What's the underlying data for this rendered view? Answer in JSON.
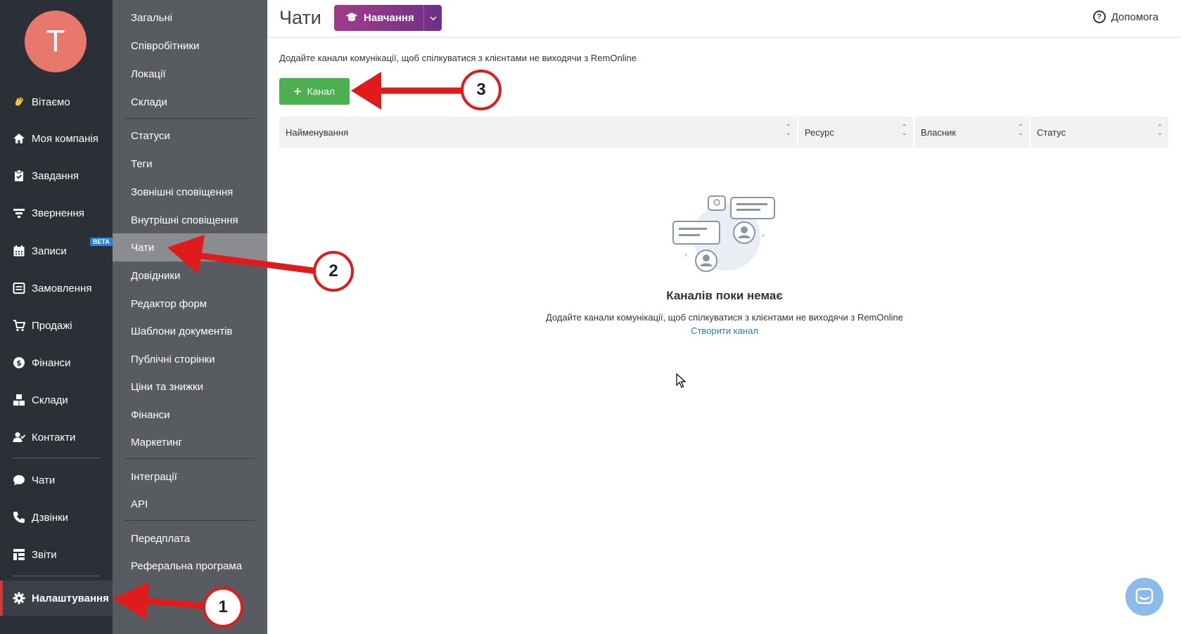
{
  "user": {
    "avatar_letter": "T"
  },
  "nav": [
    {
      "label": "Вітаємо",
      "icon": "wave-hand-icon"
    },
    {
      "label": "Моя компанія",
      "icon": "home-icon"
    },
    {
      "label": "Завдання",
      "icon": "clipboard-check-icon"
    },
    {
      "label": "Звернення",
      "icon": "funnel-icon"
    },
    {
      "label": "Записи",
      "icon": "calendar-icon",
      "badge": "BETA"
    },
    {
      "label": "Замовлення",
      "icon": "order-icon"
    },
    {
      "label": "Продажі",
      "icon": "cart-icon"
    },
    {
      "label": "Фінанси",
      "icon": "dollar-icon"
    },
    {
      "label": "Склади",
      "icon": "boxes-icon"
    },
    {
      "label": "Контакти",
      "icon": "contacts-icon"
    },
    {
      "label": "Чати",
      "icon": "chat-icon"
    },
    {
      "label": "Дзвінки",
      "icon": "phone-icon"
    },
    {
      "label": "Звіти",
      "icon": "reports-icon"
    },
    {
      "label": "Налаштування",
      "icon": "gear-icon",
      "active": true
    }
  ],
  "settings_menu": [
    "Загальні",
    "Співробітники",
    "Локації",
    "Склади",
    "Статуси",
    "Теги",
    "Зовнішні сповіщення",
    "Внутрішні сповіщення",
    "Чати",
    "Довідники",
    "Редактор форм",
    "Шаблони документів",
    "Публічні сторінки",
    "Ціни та знижки",
    "Фінанси",
    "Маркетинг",
    "Інтеграції",
    "API",
    "Передплата",
    "Реферальна програма"
  ],
  "header": {
    "title": "Чати",
    "edu_button": "Навчання",
    "help": "Допомога"
  },
  "content": {
    "intro": "Додайте канали комунікації, щоб спілкуватися з клієнтами не виходячи з RemOnline",
    "add_button": "Канал",
    "columns": [
      "Найменування",
      "Ресурс",
      "Власник",
      "Статус"
    ],
    "empty_title": "Каналів поки немає",
    "empty_desc": "Додайте канали комунікації, щоб спілкуватися з клієнтами не виходячи з RemOnline",
    "empty_link": "Створити канал"
  },
  "annotations": [
    "1",
    "2",
    "3"
  ],
  "colors": {
    "sidebar": "#2b2f36",
    "subbar": "#585b5f",
    "accent_green": "#4caf50",
    "arrow_red": "#e01b1b",
    "edu_gradient_start": "#a03d8a",
    "edu_gradient_end": "#6e2f87",
    "link": "#2a7bc4"
  }
}
